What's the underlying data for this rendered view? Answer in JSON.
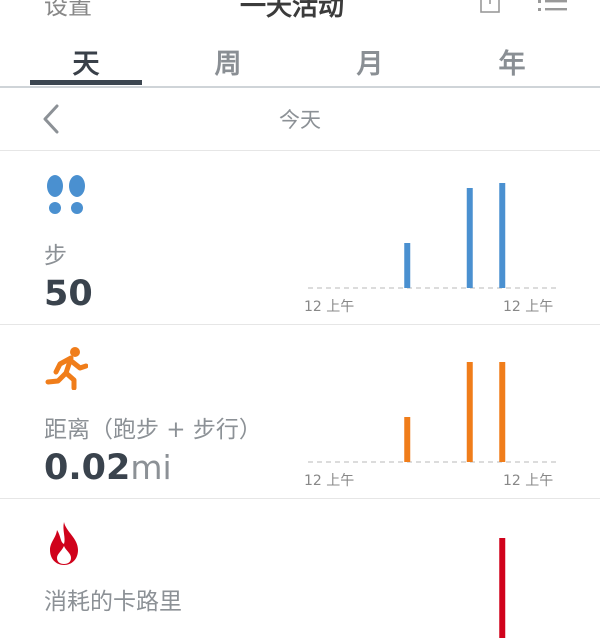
{
  "header": {
    "settings_label": "设置",
    "title": "一天活动",
    "share_icon": "share-icon",
    "list_icon": "list-icon"
  },
  "tabs": [
    {
      "label": "天",
      "active": true
    },
    {
      "label": "周",
      "active": false
    },
    {
      "label": "月",
      "active": false
    },
    {
      "label": "年",
      "active": false
    }
  ],
  "day_nav": {
    "back_icon": "chevron-left-icon",
    "label": "今天"
  },
  "cards": {
    "steps": {
      "icon": "footprints-icon",
      "label": "步",
      "value": "50",
      "color": "#4a90d0",
      "tick_left": "12 上午",
      "tick_right": "12 上午"
    },
    "distance": {
      "icon": "running-person-icon",
      "label": "距离（跑步 + 步行）",
      "value": "0.02",
      "unit": "mi",
      "color": "#f07d1a",
      "tick_left": "12 上午",
      "tick_right": "12 上午"
    },
    "calories": {
      "icon": "flame-icon",
      "label": "消耗的卡路里",
      "color": "#d0021b"
    }
  },
  "chart_data": [
    {
      "type": "bar",
      "x": [
        0.405,
        0.655,
        0.785
      ],
      "values": [
        0.45,
        1.0,
        1.05
      ],
      "xlim": [
        0,
        1
      ],
      "ylim": [
        0,
        1.1
      ],
      "tick_labels": [
        "12 上午",
        "12 上午"
      ],
      "color": "#4a90d0"
    },
    {
      "type": "bar",
      "x": [
        0.405,
        0.655,
        0.785
      ],
      "values": [
        0.45,
        1.0,
        1.0
      ],
      "xlim": [
        0,
        1
      ],
      "ylim": [
        0,
        1.1
      ],
      "tick_labels": [
        "12 上午",
        "12 上午"
      ],
      "color": "#f07d1a"
    },
    {
      "type": "bar",
      "x": [
        0.785
      ],
      "values": [
        1.0
      ],
      "xlim": [
        0,
        1
      ],
      "ylim": [
        0,
        1.1
      ],
      "color": "#d0021b"
    }
  ]
}
